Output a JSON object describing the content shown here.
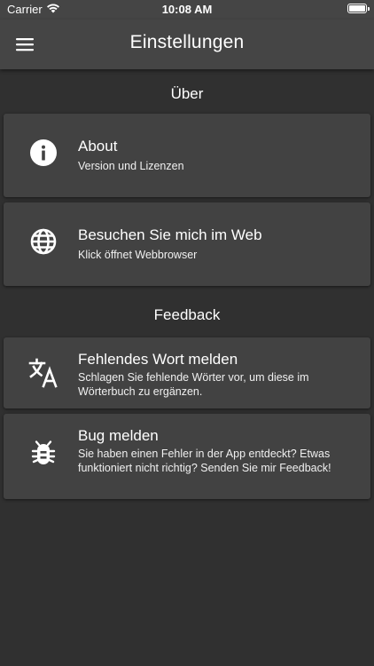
{
  "status_bar": {
    "carrier": "Carrier",
    "time": "10:08 AM",
    "wifi_icon": "wifi-icon",
    "battery_icon": "battery-icon"
  },
  "app_bar": {
    "title": "Einstellungen",
    "menu_icon": "menu-icon"
  },
  "sections": {
    "about": {
      "header": "Über",
      "items": [
        {
          "icon": "info-icon",
          "title": "About",
          "subtitle": "Version und Lizenzen"
        },
        {
          "icon": "globe-icon",
          "title": "Besuchen Sie mich im Web",
          "subtitle": "Klick öffnet Webbrowser"
        }
      ]
    },
    "feedback": {
      "header": "Feedback",
      "items": [
        {
          "icon": "translate-icon",
          "title": "Fehlendes Wort melden",
          "subtitle": "Schlagen Sie fehlende Wörter vor, um diese im Wörterbuch zu ergänzen."
        },
        {
          "icon": "bug-icon",
          "title": "Bug melden",
          "subtitle": "Sie haben einen Fehler in der App entdeckt? Etwas funktioniert nicht richtig? Senden Sie mir Feedback!"
        }
      ]
    }
  },
  "colors": {
    "background": "#303030",
    "app_bar": "#454545",
    "card": "#424242",
    "text": "#ffffff"
  }
}
